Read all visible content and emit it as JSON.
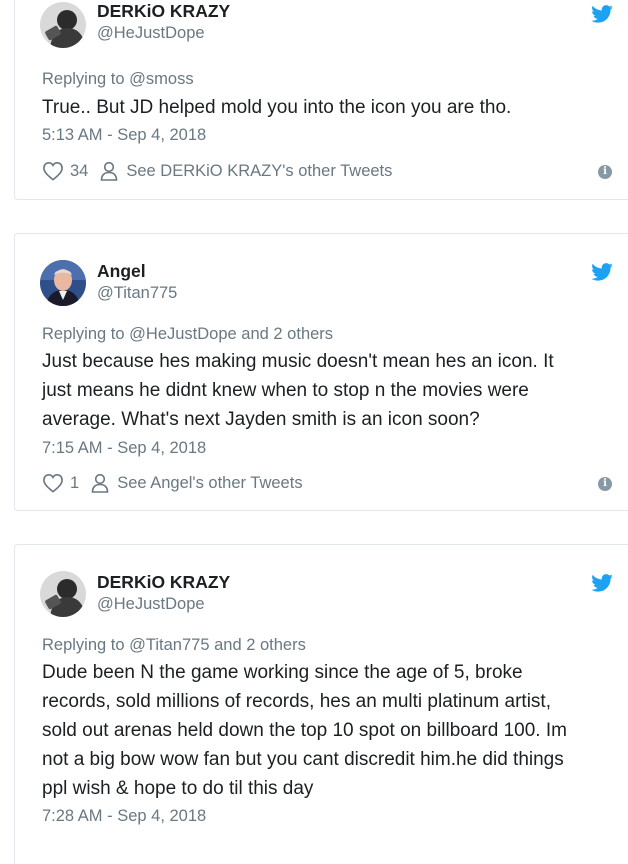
{
  "tweets": [
    {
      "author": {
        "name": "DERKiO KRAZY",
        "handle": "@HeJustDope",
        "avatar": "profile-photo"
      },
      "reply_label": "Replying to",
      "reply_targets": "@smoss",
      "reply_extra": "",
      "text": "True.. But JD helped mold you into the icon you are tho.",
      "timestamp": "5:13 AM - Sep 4, 2018",
      "likes": "34",
      "other_tweets_link": "See DERKiO KRAZY's other Tweets"
    },
    {
      "author": {
        "name": "Angel",
        "handle": "@Titan775",
        "avatar": "profile-photo"
      },
      "reply_label": "Replying to",
      "reply_targets": "@HeJustDope",
      "reply_extra": " and 2 others",
      "text_lines": [
        "Just because hes making music doesn't mean hes an icon. It",
        "just means he didnt knew when to stop n the movies were",
        "average.  What's next Jayden smith is an icon soon?"
      ],
      "timestamp": "7:15 AM - Sep 4, 2018",
      "likes": "1",
      "other_tweets_link": "See Angel's other Tweets"
    },
    {
      "author": {
        "name": "DERKiO KRAZY",
        "handle": "@HeJustDope",
        "avatar": "profile-photo"
      },
      "reply_label": "Replying to",
      "reply_targets": "@Titan775",
      "reply_extra": " and 2 others",
      "text_lines": [
        "Dude been N the game working since the age of 5, broke",
        "records, sold millions of records, hes an multi platinum artist,",
        "sold out arenas held down the top 10 spot on billboard 100. Im",
        "not a big bow wow fan but you cant discredit him.he did things",
        "ppl wish & hope to do til this day"
      ],
      "timestamp": "7:28 AM - Sep 4, 2018"
    }
  ],
  "icons": {
    "bird": "twitter-bird-icon",
    "heart": "heart-icon",
    "person": "person-icon",
    "info": "info-icon"
  },
  "colors": {
    "twitter_blue": "#1da1f2",
    "muted": "#697882",
    "text": "#1c2022",
    "border": "#e1e8ed"
  }
}
